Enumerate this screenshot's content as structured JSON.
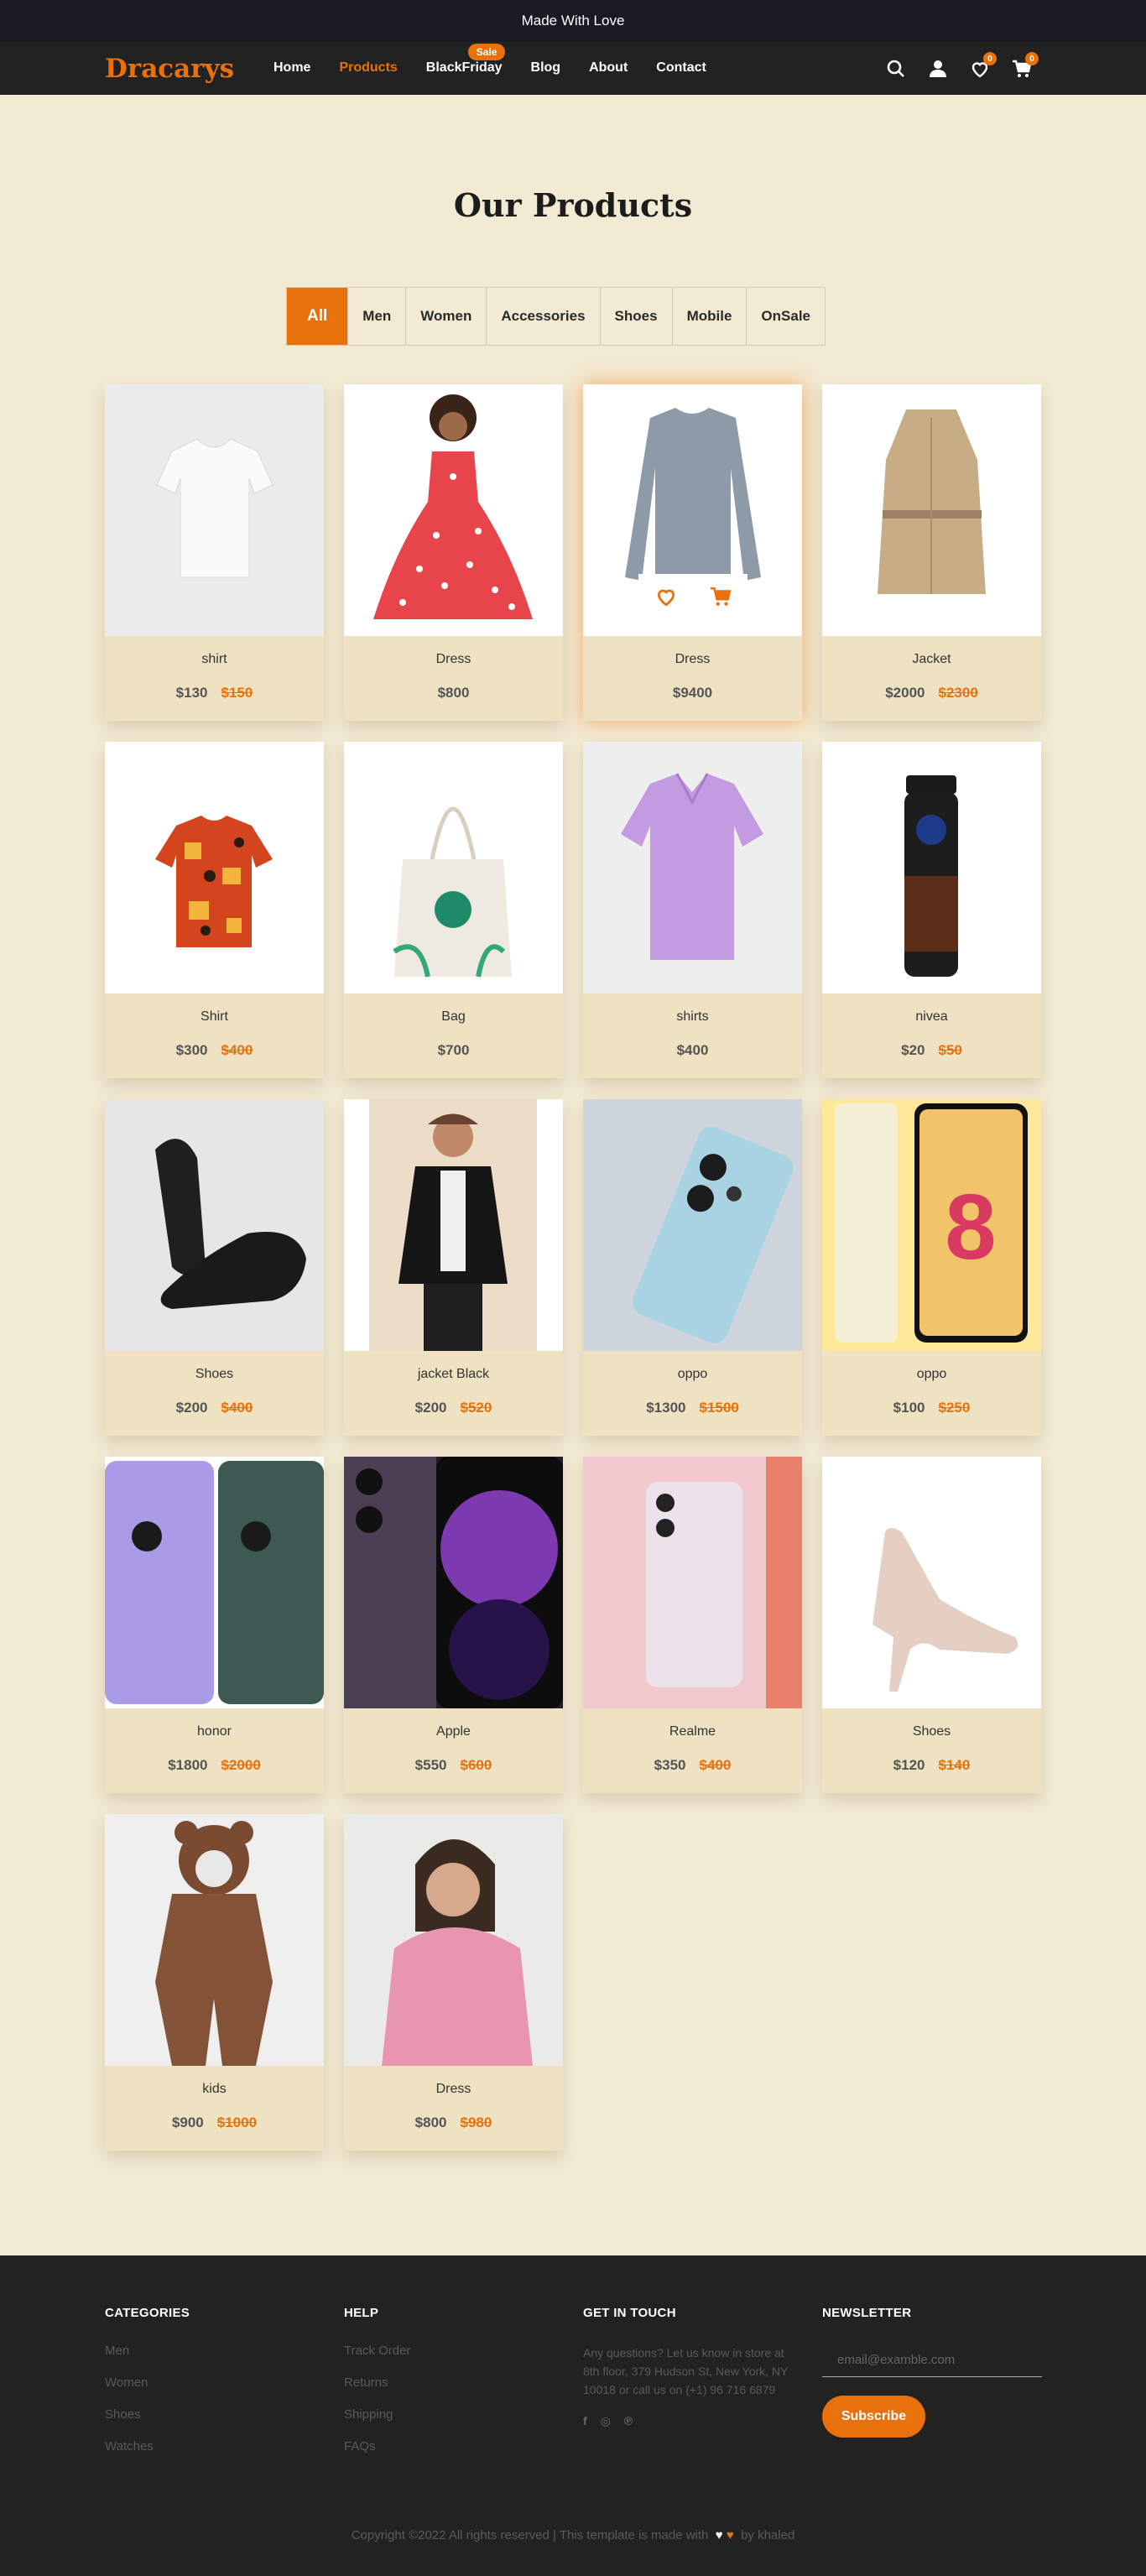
{
  "topbar": {
    "text": "Made With Love"
  },
  "nav": {
    "logo": "Dracarys",
    "links": [
      "Home",
      "Products",
      "BlackFriday",
      "Blog",
      "About",
      "Contact"
    ],
    "sale_badge": "Sale",
    "wishlist_count": "0",
    "cart_count": "0",
    "accent": "#e8710c"
  },
  "main": {
    "title": "Our Products",
    "filters": [
      "All",
      "Men",
      "Women",
      "Accessories",
      "Shoes",
      "Mobile",
      "OnSale"
    ],
    "active_filter": "All",
    "products": [
      {
        "name": "shirt",
        "price": "$130",
        "old_price": "$150",
        "image": "white-tshirt"
      },
      {
        "name": "Dress",
        "price": "$800",
        "old_price": "",
        "image": "red-polka-dress"
      },
      {
        "name": "Dress",
        "price": "$9400",
        "old_price": "",
        "image": "grey-longsleeve"
      },
      {
        "name": "Jacket",
        "price": "$2000",
        "old_price": "$2300",
        "image": "beige-trench-coat"
      },
      {
        "name": "Shirt",
        "price": "$300",
        "old_price": "$400",
        "image": "patterned-shirt"
      },
      {
        "name": "Bag",
        "price": "$700",
        "old_price": "",
        "image": "tote-bag"
      },
      {
        "name": "shirts",
        "price": "$400",
        "old_price": "",
        "image": "purple-polo"
      },
      {
        "name": "nivea",
        "price": "$20",
        "old_price": "$50",
        "image": "nivea-men-spray"
      },
      {
        "name": "Shoes",
        "price": "$200",
        "old_price": "$400",
        "image": "black-shoes"
      },
      {
        "name": "jacket Black",
        "price": "$200",
        "old_price": "$520",
        "image": "man-black-jacket"
      },
      {
        "name": "oppo",
        "price": "$1300",
        "old_price": "$1500",
        "image": "oppo-blue-phone"
      },
      {
        "name": "oppo",
        "price": "$100",
        "old_price": "$250",
        "image": "oppo-reno8"
      },
      {
        "name": "honor",
        "price": "$1800",
        "old_price": "$2000",
        "image": "honor-phones"
      },
      {
        "name": "Apple",
        "price": "$550",
        "old_price": "$600",
        "image": "iphone-purple"
      },
      {
        "name": "Realme",
        "price": "$350",
        "old_price": "$400",
        "image": "realme-phone"
      },
      {
        "name": "Shoes",
        "price": "$120",
        "old_price": "$140",
        "image": "beige-heels"
      },
      {
        "name": "kids",
        "price": "$900",
        "old_price": "$1000",
        "image": "baby-bear-suit"
      },
      {
        "name": "Dress",
        "price": "$800",
        "old_price": "$980",
        "image": "woman-pink-jacket"
      }
    ]
  },
  "footer": {
    "categories": {
      "title": "CATEGORIES",
      "items": [
        "Men",
        "Women",
        "Shoes",
        "Watches"
      ]
    },
    "help": {
      "title": "HELP",
      "items": [
        "Track Order",
        "Returns",
        "Shipping",
        "FAQs"
      ]
    },
    "contact": {
      "title": "GET IN TOUCH",
      "text": "Any questions? Let us know in store at 8th floor, 379 Hudson St, New York, NY 10018 or call us on (+1) 96 716 6879",
      "social": [
        "f",
        "◎",
        "℗"
      ]
    },
    "newsletter": {
      "title": "NEWSLETTER",
      "placeholder": "email@examble.com",
      "button": "Subscribe"
    },
    "copyright_text": "Copyright ©2022 All rights reserved | This template is made with",
    "copyright_by": "by khaled"
  }
}
